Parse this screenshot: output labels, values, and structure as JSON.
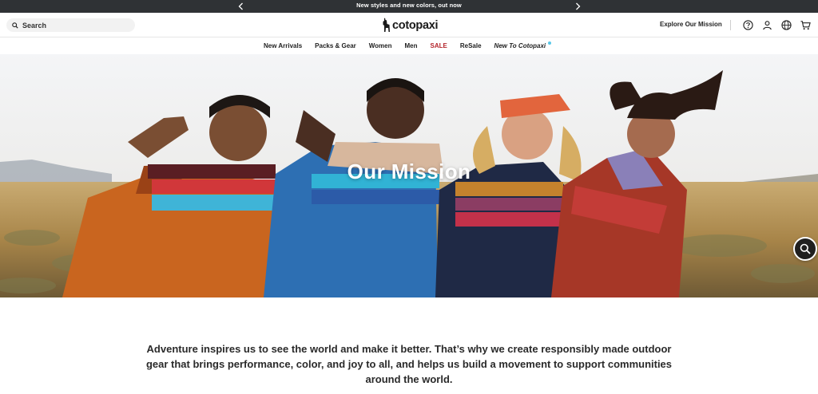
{
  "announcement": {
    "message": "New styles and new colors, out now",
    "prev_icon": "chevron-left-icon",
    "next_icon": "chevron-right-icon"
  },
  "header": {
    "search_placeholder": "Search",
    "logo_text": "cotopaxi",
    "explore_link": "Explore Our Mission",
    "icons": [
      "help-icon",
      "account-icon",
      "globe-icon",
      "cart-icon"
    ]
  },
  "nav": {
    "items": [
      "New Arrivals",
      "Packs & Gear",
      "Women",
      "Men",
      "SALE",
      "ReSale",
      "New To Cotopaxi"
    ]
  },
  "hero": {
    "title": "Our Mission",
    "zoom_icon": "zoom-in-icon"
  },
  "mission": {
    "text": "Adventure inspires us to see the world and make it better. That’s why we create responsibly made outdoor gear that brings performance, color, and joy to all, and helps us build a movement to support communities around the world."
  },
  "colors": {
    "announcement_bg": "#2f3235",
    "sale_red": "#b4262c",
    "new_dot": "#59c7e8",
    "sky": "#eef1f4",
    "field": "#b4935a"
  }
}
